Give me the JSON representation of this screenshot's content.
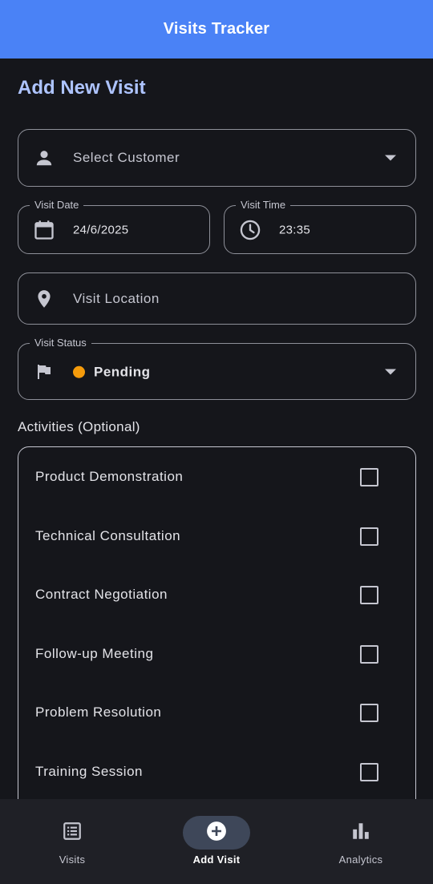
{
  "app": {
    "title": "Visits Tracker"
  },
  "page": {
    "title": "Add New Visit"
  },
  "form": {
    "customer": {
      "placeholder": "Select Customer",
      "icon": "person-icon"
    },
    "visit_date": {
      "label": "Visit Date",
      "value": "24/6/2025",
      "icon": "calendar-icon"
    },
    "visit_time": {
      "label": "Visit Time",
      "value": "23:35",
      "icon": "clock-icon"
    },
    "location": {
      "placeholder": "Visit Location",
      "icon": "location-pin-icon"
    },
    "status": {
      "label": "Visit Status",
      "value": "Pending",
      "color": "#f59b0b",
      "icon": "flag-icon"
    }
  },
  "activities": {
    "label": "Activities (Optional)",
    "items": [
      {
        "label": "Product Demonstration",
        "checked": false
      },
      {
        "label": "Technical Consultation",
        "checked": false
      },
      {
        "label": "Contract Negotiation",
        "checked": false
      },
      {
        "label": "Follow-up Meeting",
        "checked": false
      },
      {
        "label": "Problem Resolution",
        "checked": false
      },
      {
        "label": "Training Session",
        "checked": false
      }
    ]
  },
  "nav": {
    "items": [
      {
        "label": "Visits",
        "icon": "list-icon",
        "active": false
      },
      {
        "label": "Add Visit",
        "icon": "add-circle-icon",
        "active": true
      },
      {
        "label": "Analytics",
        "icon": "bar-chart-icon",
        "active": false
      }
    ]
  },
  "colors": {
    "appbar": "#4a82f6",
    "background": "#15161b",
    "title_accent": "#aec4ff",
    "pending": "#f59b0b",
    "nav_active_pill": "#3e4759"
  }
}
